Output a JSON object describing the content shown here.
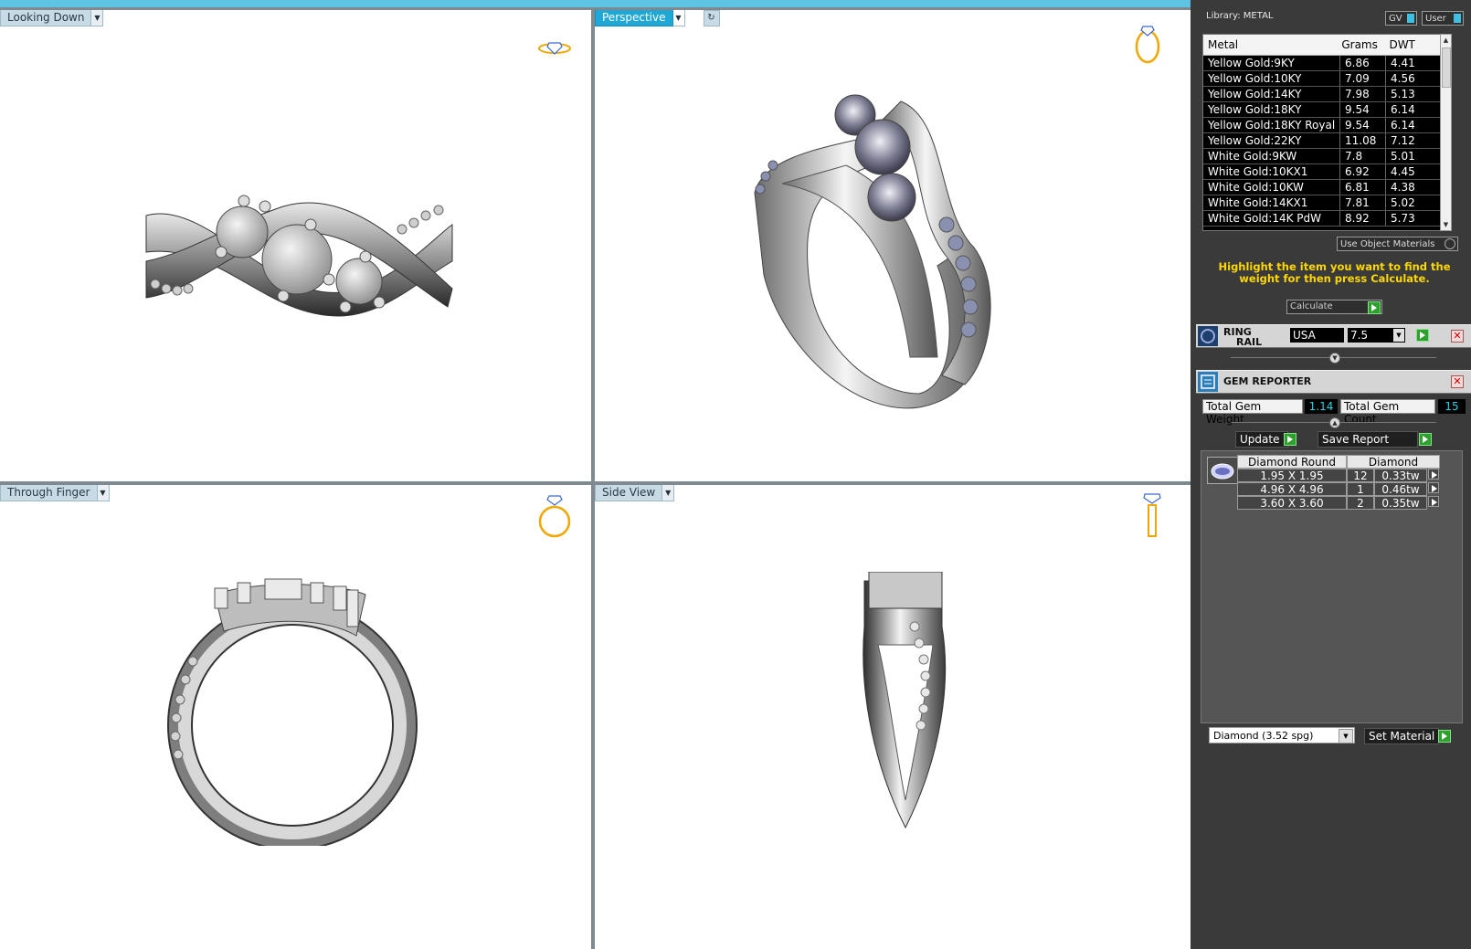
{
  "viewports": {
    "top_left": {
      "label": "Looking Down"
    },
    "top_right": {
      "label": "Perspective"
    },
    "bottom_left": {
      "label": "Through Finger"
    },
    "bottom_right": {
      "label": "Side View"
    }
  },
  "library": {
    "title": "Library: METAL",
    "gv_label": "GV",
    "user_label": "User",
    "columns": [
      "Metal",
      "Grams",
      "DWT"
    ],
    "rows": [
      [
        "Yellow Gold:9KY",
        "6.86",
        "4.41"
      ],
      [
        "Yellow Gold:10KY",
        "7.09",
        "4.56"
      ],
      [
        "Yellow Gold:14KY",
        "7.98",
        "5.13"
      ],
      [
        "Yellow Gold:18KY",
        "9.54",
        "6.14"
      ],
      [
        "Yellow Gold:18KY Royal",
        "9.54",
        "6.14"
      ],
      [
        "Yellow Gold:22KY",
        "11.08",
        "7.12"
      ],
      [
        "White Gold:9KW",
        "7.8",
        "5.01"
      ],
      [
        "White Gold:10KX1",
        "6.92",
        "4.45"
      ],
      [
        "White Gold:10KW",
        "6.81",
        "4.38"
      ],
      [
        "White Gold:14KX1",
        "7.81",
        "5.02"
      ],
      [
        "White Gold:14K PdW",
        "8.92",
        "5.73"
      ]
    ],
    "use_object_materials": "Use Object Materials",
    "hint": "Highlight the item you want to find the weight for then press Calculate.",
    "calculate_label": "Calculate"
  },
  "ring_rail": {
    "title_line1": "RING",
    "title_line2": "RAIL",
    "region": "USA",
    "size": "7.5"
  },
  "gem_reporter": {
    "title": "GEM REPORTER",
    "total_weight_label": "Total Gem Weight",
    "total_weight_value": "1.14",
    "total_count_label": "Total Gem Count",
    "total_count_value": "15",
    "update_label": "Update",
    "save_label": "Save Report",
    "table_head": [
      "Diamond Round",
      "Diamond"
    ],
    "rows": [
      [
        "1.95 X 1.95",
        "12",
        "0.33tw"
      ],
      [
        "4.96 X 4.96",
        "1",
        "0.46tw"
      ],
      [
        "3.60 X 3.60",
        "2",
        "0.35tw"
      ]
    ],
    "material_select": "Diamond      (3.52 spg)",
    "set_material_label": "Set Material"
  },
  "colors": {
    "accent": "#1fa7d6",
    "hint": "#ffd700",
    "go": "#2ea02e",
    "readout": "#22d3e6"
  }
}
